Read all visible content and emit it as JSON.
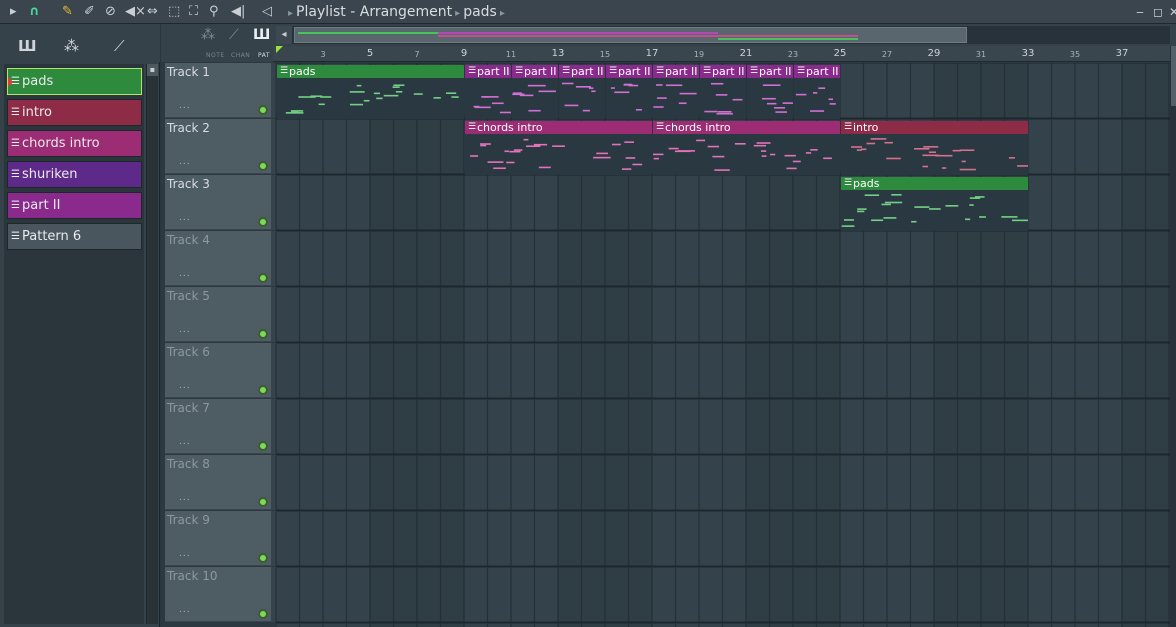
{
  "titlebar": {
    "path": [
      "Playlist - Arrangement",
      "pads"
    ],
    "icons": [
      "play-arrow-icon",
      "magnet-snap-icon",
      "draw-pencil-icon",
      "paint-brush-icon",
      "delete-icon",
      "mute-icon",
      "slip-icon",
      "select-icon",
      "zoom-icon",
      "playback-icon"
    ]
  },
  "left_tools": [
    "piano-roll-icon",
    "audio-wave-icon",
    "automation-icon"
  ],
  "patterns": [
    {
      "label": "pads",
      "color": "#2e8b3e",
      "selected": true
    },
    {
      "label": "intro",
      "color": "#8e2c47"
    },
    {
      "label": "chords intro",
      "color": "#9c2d74"
    },
    {
      "label": "shuriken",
      "color": "#5e2a8a"
    },
    {
      "label": "part II",
      "color": "#8a2a8c"
    },
    {
      "label": "Pattern 6",
      "color": "#4a565d"
    }
  ],
  "mode_labels": [
    "NOTE",
    "CHAN",
    "PAT"
  ],
  "ruler": {
    "major": [
      {
        "bar": 3,
        "label": "3"
      },
      {
        "bar": 5,
        "label": "5"
      },
      {
        "bar": 7,
        "label": "7"
      },
      {
        "bar": 9,
        "label": "9"
      },
      {
        "bar": 11,
        "label": "11"
      },
      {
        "bar": 13,
        "label": "13"
      },
      {
        "bar": 15,
        "label": "15"
      },
      {
        "bar": 17,
        "label": "17"
      },
      {
        "bar": 19,
        "label": "19"
      },
      {
        "bar": 21,
        "label": "21"
      },
      {
        "bar": 23,
        "label": "23"
      },
      {
        "bar": 25,
        "label": "25"
      },
      {
        "bar": 27,
        "label": "27"
      },
      {
        "bar": 29,
        "label": "29"
      },
      {
        "bar": 31,
        "label": "31"
      },
      {
        "bar": 33,
        "label": "33"
      },
      {
        "bar": 35,
        "label": "35"
      },
      {
        "bar": 37,
        "label": "37"
      }
    ]
  },
  "tracks": [
    {
      "name": "Track 1"
    },
    {
      "name": "Track 2"
    },
    {
      "name": "Track 3"
    },
    {
      "name": "Track 4"
    },
    {
      "name": "Track 5"
    },
    {
      "name": "Track 6"
    },
    {
      "name": "Track 7"
    },
    {
      "name": "Track 8"
    },
    {
      "name": "Track 9"
    },
    {
      "name": "Track 10"
    }
  ],
  "clips": [
    {
      "track": 1,
      "start": 1,
      "end": 9,
      "label": "pads",
      "color": "#2e8b3e"
    },
    {
      "track": 1,
      "start": 9,
      "end": 11,
      "label": "part II",
      "color": "#8a2a8c"
    },
    {
      "track": 1,
      "start": 11,
      "end": 13,
      "label": "part II",
      "color": "#8a2a8c"
    },
    {
      "track": 1,
      "start": 13,
      "end": 15,
      "label": "part II",
      "color": "#8a2a8c"
    },
    {
      "track": 1,
      "start": 15,
      "end": 17,
      "label": "part II",
      "color": "#8a2a8c"
    },
    {
      "track": 1,
      "start": 17,
      "end": 19,
      "label": "part II",
      "color": "#8a2a8c"
    },
    {
      "track": 1,
      "start": 19,
      "end": 21,
      "label": "part II",
      "color": "#8a2a8c"
    },
    {
      "track": 1,
      "start": 21,
      "end": 23,
      "label": "part II",
      "color": "#8a2a8c"
    },
    {
      "track": 1,
      "start": 23,
      "end": 25,
      "label": "part II",
      "color": "#8a2a8c"
    },
    {
      "track": 2,
      "start": 9,
      "end": 17,
      "label": "chords intro",
      "color": "#9c2d74"
    },
    {
      "track": 2,
      "start": 17,
      "end": 25,
      "label": "chords intro",
      "color": "#9c2d74"
    },
    {
      "track": 2,
      "start": 25,
      "end": 33,
      "label": "intro",
      "color": "#8e2c47"
    },
    {
      "track": 3,
      "start": 25,
      "end": 33,
      "label": "pads",
      "color": "#2e8b3e"
    }
  ]
}
